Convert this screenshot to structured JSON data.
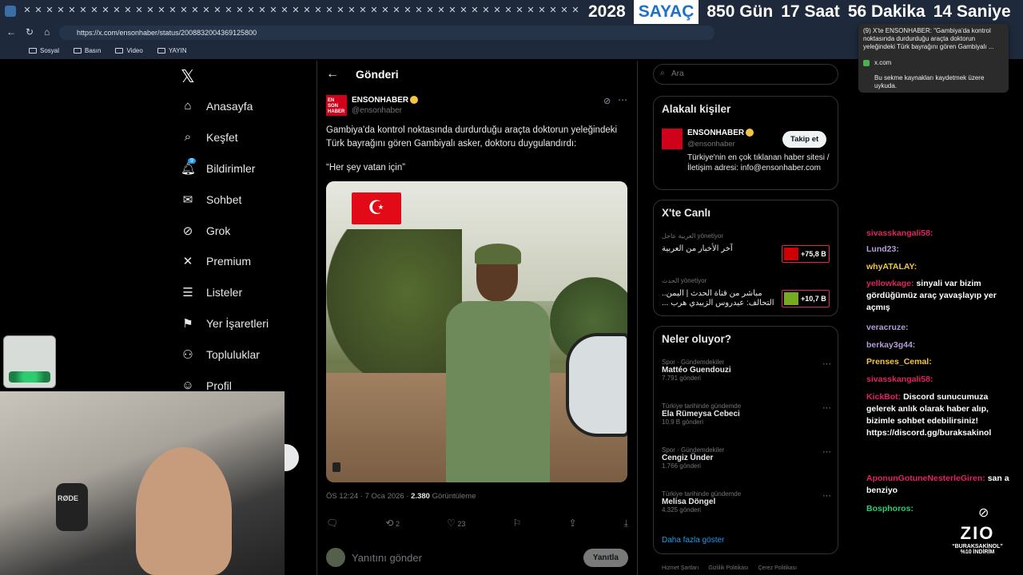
{
  "browser": {
    "url": "https://x.com/ensonhaber/status/2008832004369125800",
    "bookmarks": [
      "Sosyal",
      "Basın",
      "Video",
      "YAYIN"
    ],
    "notification": {
      "title": "(9) X'te ENSONHABER: \"Gambiya'da kontrol noktasında durdurduğu araçta doktorun yeleğindeki Türk bayrağını gören Gambiyalı ...",
      "site": "x.com",
      "note": "Bu sekme kaynakları kaydetmek üzere uykuda."
    }
  },
  "countdown": {
    "year": "2028",
    "label": "SAYAÇ",
    "days": "850 Gün",
    "hours": "17 Saat",
    "minutes": "56 Dakika",
    "seconds": "14 Saniye"
  },
  "nav": {
    "items": [
      {
        "label": "Anasayfa",
        "icon": "home-icon"
      },
      {
        "label": "Keşfet",
        "icon": "search-icon"
      },
      {
        "label": "Bildirimler",
        "icon": "bell-icon",
        "badge": "9"
      },
      {
        "label": "Sohbet",
        "icon": "mail-icon"
      },
      {
        "label": "Grok",
        "icon": "grok-icon"
      },
      {
        "label": "Premium",
        "icon": "x-logo-icon"
      },
      {
        "label": "Listeler",
        "icon": "list-icon"
      },
      {
        "label": "Yer İşaretleri",
        "icon": "bookmark-icon"
      },
      {
        "label": "Topluluklar",
        "icon": "people-icon"
      },
      {
        "label": "Profil",
        "icon": "user-icon"
      }
    ]
  },
  "post": {
    "header": "Gönderi",
    "author": "ENSONHABER",
    "handle": "@ensonhaber",
    "avatar_text": "EN SON HABER",
    "text": "Gambiya'da kontrol noktasında durdurduğu araçta doktorun yeleğindeki Türk bayrağını gören Gambiyalı asker, doktoru duygulandırdı:",
    "quote": "“Her şey vatan için”",
    "time": "ÖS 12:24 · 7 Oca 2026 · ",
    "views": "2.380",
    "views_label": " Görüntüleme",
    "retweets": "2",
    "likes": "23",
    "reply_placeholder": "Yanıtını gönder",
    "reply_button": "Yanıtla"
  },
  "sidebar": {
    "search_placeholder": "Ara",
    "related_title": "Alakalı kişiler",
    "related": {
      "name": "ENSONHABER",
      "handle": "@ensonhaber",
      "bio": "Türkiye'nin en çok tıklanan haber sitesi / İletişim adresi: info@ensonhaber.com",
      "follow": "Takip et"
    },
    "live_title": "X'te Canlı",
    "live": [
      {
        "channel": "العربية عاجل",
        "role": "yönetiyor",
        "title": "آخر الأخبار من العربية",
        "count": "+75,8 B"
      },
      {
        "channel": "الحدث",
        "role": "yönetiyor",
        "title": "مباشر من قناة الحدث | اليمن.. التحالف: عيدروس الزبيدي هرب ...",
        "count": "+10,7 B"
      }
    ],
    "trends_title": "Neler oluyor?",
    "trends": [
      {
        "category": "Spor · Gündemdekiler",
        "name": "Mattéo Guendouzi",
        "count": "7.791 gönderi"
      },
      {
        "category": "Türkiye tarihinde gündemde",
        "name": "Ela Rümeysa Cebeci",
        "count": "10,9 B gönderi"
      },
      {
        "category": "Spor · Gündemdekiler",
        "name": "Cengiz Ünder",
        "count": "1.766 gönderi"
      },
      {
        "category": "Türkiye tarihinde gündemde",
        "name": "Melisa Döngel",
        "count": "4.325 gönderi"
      }
    ],
    "show_more": "Daha fazla göster",
    "footer": [
      "Hizmet Şartları",
      "Gizlilik Politikası",
      "Çerez Politikası"
    ]
  },
  "chat": [
    {
      "user": "sivasskangali58:",
      "msg": ""
    },
    {
      "user": "Lund23:",
      "msg": ""
    },
    {
      "user": "whyATALAY:",
      "msg": ""
    },
    {
      "user": "yellowkage:",
      "msg": "sinyali var bizim gördüğümüz araç yavaşlayıp yer açmış"
    },
    {
      "user": "veracruze:",
      "msg": ""
    },
    {
      "user": "berkay3g44:",
      "msg": ""
    },
    {
      "user": "Prenses_Cemal:",
      "msg": ""
    },
    {
      "user": "sivasskangali58:",
      "msg": ""
    },
    {
      "user": "KickBot:",
      "msg": "Discord sunucumuza gelerek anlık olarak haber alıp, bizimle sohbet edebilirsiniz! https://discord.gg/buraksakinol"
    },
    {
      "user": "AponunGotuneNesterleGiren:",
      "msg": "san a benziyo"
    },
    {
      "user": "Bosphoros:",
      "msg": ""
    }
  ],
  "promo": {
    "brand": "ZIO",
    "code": "“BURAKSAKİNOL”",
    "discount": "%10 İNDİRİM"
  },
  "colors": {
    "accent": "#1d9bf0",
    "bg": "#000000",
    "live_red": "#e0245e"
  }
}
